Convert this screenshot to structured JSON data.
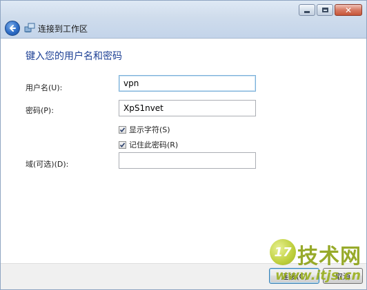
{
  "window": {
    "title": "连接到工作区",
    "caption_buttons": [
      "minimize",
      "maximize",
      "close"
    ]
  },
  "form": {
    "heading": "键入您的用户名和密码",
    "username_label": "用户名(U):",
    "username_value": "vpn",
    "password_label": "密码(P):",
    "password_value": "XpS1nvet",
    "show_chars_label": "显示字符(S)",
    "show_chars_checked": true,
    "remember_label": "记住此密码(R)",
    "remember_checked": true,
    "domain_label": "域(可选)(D):",
    "domain_value": ""
  },
  "buttons": {
    "connect_label": "连接(C)",
    "cancel_label": "取消"
  },
  "watermark": {
    "logo_text": "17",
    "site_name": "技术网",
    "url": "www.itjs.cn",
    "accent": "#98ae17"
  },
  "icons": {
    "back": "back-arrow-icon",
    "network": "network-icon",
    "checkbox": "checkmark-icon"
  }
}
